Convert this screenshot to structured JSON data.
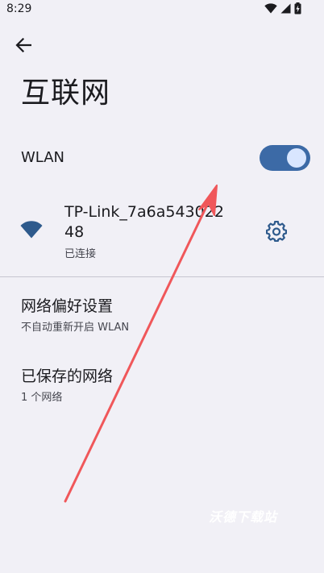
{
  "status_bar": {
    "time": "8:29"
  },
  "header": {
    "title": "互联网"
  },
  "wlan": {
    "label": "WLAN",
    "enabled": true
  },
  "network": {
    "name": "TP-Link_7a6a54302248",
    "status": "已连接"
  },
  "preferences": [
    {
      "title": "网络偏好设置",
      "subtitle": "不自动重新开启 WLAN"
    },
    {
      "title": "已保存的网络",
      "subtitle": "1 个网络"
    }
  ],
  "watermark": "沃德下载站",
  "colors": {
    "background": "#f1f0f6",
    "accent": "#3c6aa6",
    "toggle_knob": "#d9e6ff",
    "annotation": "#f0575a"
  }
}
